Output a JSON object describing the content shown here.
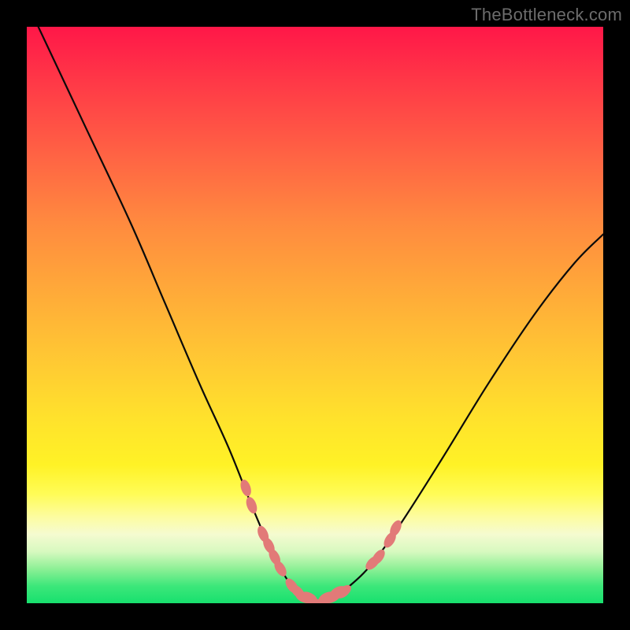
{
  "watermark": "TheBottleneck.com",
  "colors": {
    "frame": "#000000",
    "curve": "#0a0a0a",
    "marker_fill": "#e27a78",
    "marker_stroke": "#c96160",
    "gradient_top": "#ff1748",
    "gradient_bottom": "#17e06e"
  },
  "chart_data": {
    "type": "line",
    "title": "",
    "xlabel": "",
    "ylabel": "",
    "xlim": [
      0,
      100
    ],
    "ylim": [
      0,
      100
    ],
    "series": [
      {
        "name": "left-branch",
        "x": [
          2,
          10,
          18,
          24,
          30,
          35,
          39,
          42,
          44,
          46,
          48,
          50
        ],
        "y": [
          100,
          83,
          66,
          52,
          38,
          27,
          17,
          10,
          6,
          3,
          1,
          0
        ]
      },
      {
        "name": "right-branch",
        "x": [
          50,
          53,
          56,
          60,
          65,
          72,
          80,
          88,
          95,
          100
        ],
        "y": [
          0,
          1,
          3,
          7,
          14,
          25,
          38,
          50,
          59,
          64
        ]
      }
    ],
    "markers": {
      "name": "highlighted-points",
      "points": [
        {
          "x": 38,
          "y": 20
        },
        {
          "x": 39,
          "y": 17
        },
        {
          "x": 41,
          "y": 12
        },
        {
          "x": 42,
          "y": 10
        },
        {
          "x": 43,
          "y": 8
        },
        {
          "x": 44,
          "y": 6
        },
        {
          "x": 46,
          "y": 3
        },
        {
          "x": 47,
          "y": 2
        },
        {
          "x": 48,
          "y": 1
        },
        {
          "x": 49,
          "y": 1
        },
        {
          "x": 50,
          "y": 0
        },
        {
          "x": 51,
          "y": 0
        },
        {
          "x": 52,
          "y": 1
        },
        {
          "x": 53,
          "y": 1
        },
        {
          "x": 54,
          "y": 2
        },
        {
          "x": 55,
          "y": 2
        },
        {
          "x": 60,
          "y": 7
        },
        {
          "x": 61,
          "y": 8
        },
        {
          "x": 63,
          "y": 11
        },
        {
          "x": 64,
          "y": 13
        }
      ]
    }
  }
}
